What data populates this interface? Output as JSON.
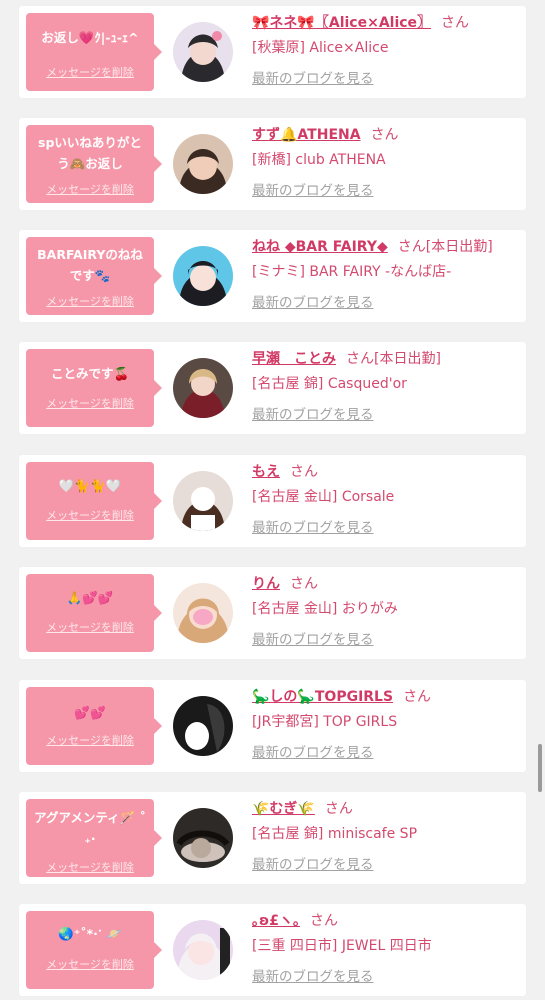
{
  "delete_label": "メッセージを削除",
  "blog_label": "最新のブログを見る",
  "san_label": "さん",
  "colors": {
    "bubble": "#f697a9",
    "accent": "#d23a66",
    "muted": "#a2a2a2",
    "background": "#f1f1f1"
  },
  "items": [
    {
      "message": "お返し💗ｸ|-ｭ-ｪ^",
      "name": "🎀ネネ🎀〖Alice×Alice〗",
      "status": "",
      "shop": "[秋葉原] Alice×Alice"
    },
    {
      "message": "spいいねありがとう🙈お返し",
      "name": "すず🔔ATHENA",
      "status": "",
      "shop": "[新橋] club ATHENA"
    },
    {
      "message": "BARFAIRYのねねです🐾",
      "name": "ねね ◆BAR FAIRY◆",
      "status": "[本日出勤]",
      "shop": "[ミナミ] BAR FAIRY -なんば店-"
    },
    {
      "message": "ことみです🍒",
      "name": "早瀬　ことみ",
      "status": "[本日出勤]",
      "shop": "[名古屋 錦] Casqued'or"
    },
    {
      "message": "🤍🐈🐈🤍",
      "name": "もえ",
      "status": "",
      "shop": "[名古屋 金山] Corsale"
    },
    {
      "message": "🙏💕💕",
      "name": "りん",
      "status": "",
      "shop": "[名古屋 金山] おりがみ"
    },
    {
      "message": "💕💕",
      "name": "🦕しの🦕TOPGIRLS",
      "status": "",
      "shop": "[JR宇都宮] TOP GIRLS"
    },
    {
      "message": "アグアメンティ🪄 ˚₊·",
      "name": "🌾むぎ🌾",
      "status": "",
      "shop": "[名古屋 錦] miniscafe SP"
    },
    {
      "message": "🌏⁺˚*·ॱ 🪐",
      "name": "｡ʚ£ヽ｡",
      "status": "",
      "shop": "[三重 四日市] JEWEL 四日市"
    }
  ]
}
